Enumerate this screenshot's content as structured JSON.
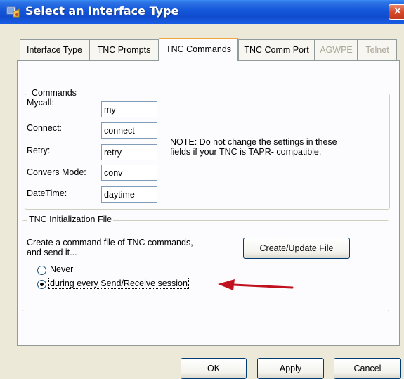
{
  "window": {
    "title": "Select an Interface Type",
    "close_glyph": "✕",
    "icon": "interface-app-icon"
  },
  "tabs": [
    {
      "label": "Interface Type",
      "active": false,
      "enabled": true
    },
    {
      "label": "TNC Prompts",
      "active": false,
      "enabled": true
    },
    {
      "label": "TNC Commands",
      "active": true,
      "enabled": true
    },
    {
      "label": "TNC Comm Port",
      "active": false,
      "enabled": true
    },
    {
      "label": "AGWPE",
      "active": false,
      "enabled": false
    },
    {
      "label": "Telnet",
      "active": false,
      "enabled": false
    }
  ],
  "commands": {
    "legend": "Commands",
    "fields": [
      {
        "label": "Mycall:",
        "value": "my"
      },
      {
        "label": "Connect:",
        "value": "connect"
      },
      {
        "label": "Retry:",
        "value": "retry"
      },
      {
        "label": "Convers Mode:",
        "value": "conv"
      },
      {
        "label": "DateTime:",
        "value": "daytime"
      }
    ],
    "note_line1": "NOTE:  Do not change the settings in these",
    "note_line2": "fields if your TNC is TAPR- compatible."
  },
  "init_file": {
    "legend": "TNC Initialization File",
    "desc_line1": "Create a command file of TNC commands,",
    "desc_line2": "and send it...",
    "create_button": "Create/Update File",
    "options": [
      {
        "label": "Never",
        "selected": false
      },
      {
        "label": "during every Send/Receive session",
        "selected": true
      }
    ]
  },
  "footer": {
    "ok": "OK",
    "apply": "Apply",
    "cancel": "Cancel"
  },
  "colors": {
    "titlebar": "#0f4ccd",
    "dialog_bg": "#ece9d8",
    "active_tab_highlight": "#f3a63b",
    "annotation_arrow": "#c1121f"
  }
}
